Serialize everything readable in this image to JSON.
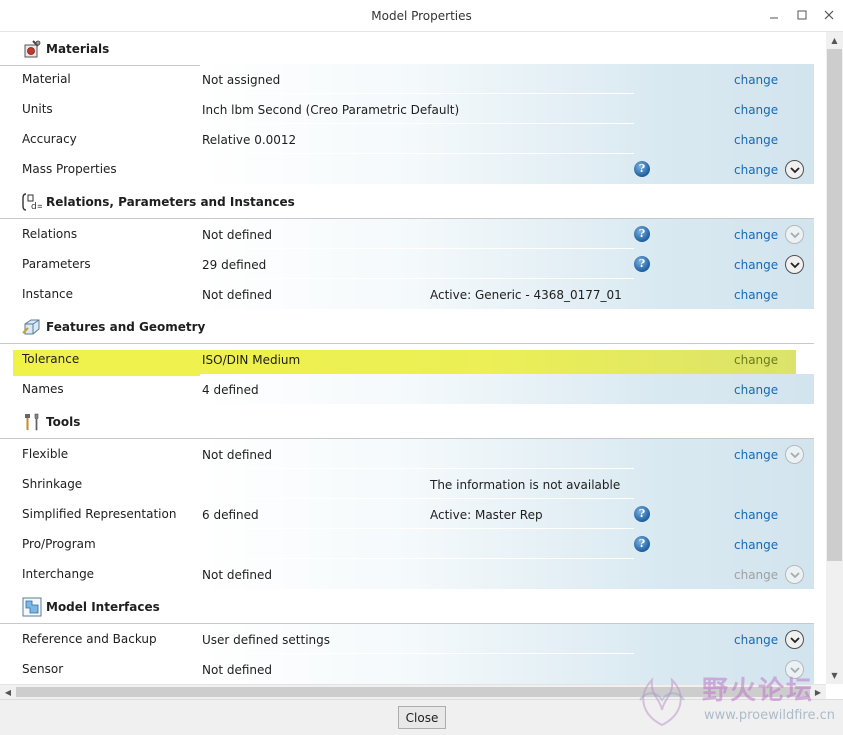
{
  "window": {
    "title": "Model Properties"
  },
  "sections": {
    "materials": {
      "title": "Materials",
      "rows": [
        {
          "label": "Material",
          "value": "Not assigned",
          "action": "change"
        },
        {
          "label": "Units",
          "value": "Inch lbm Second (Creo Parametric Default)",
          "action": "change"
        },
        {
          "label": "Accuracy",
          "value": "Relative 0.0012",
          "action": "change"
        },
        {
          "label": "Mass Properties",
          "value": "",
          "action": "change"
        }
      ]
    },
    "relations": {
      "title": "Relations, Parameters and Instances",
      "rows": [
        {
          "label": "Relations",
          "value": "Not defined",
          "action": "change"
        },
        {
          "label": "Parameters",
          "value": "29 defined",
          "action": "change"
        },
        {
          "label": "Instance",
          "value": "Not defined",
          "extra": "Active: Generic - 4368_0177_01",
          "action": "change"
        }
      ]
    },
    "features": {
      "title": "Features and Geometry",
      "rows": [
        {
          "label": "Tolerance",
          "value": "ISO/DIN Medium",
          "action": "change"
        },
        {
          "label": "Names",
          "value": "4 defined",
          "action": "change"
        }
      ]
    },
    "tools": {
      "title": "Tools",
      "rows": [
        {
          "label": "Flexible",
          "value": "Not defined",
          "action": "change"
        },
        {
          "label": "Shrinkage",
          "value": "",
          "extra": "The information is not available"
        },
        {
          "label": "Simplified Representation",
          "value": "6 defined",
          "extra": "Active: Master Rep",
          "action": "change"
        },
        {
          "label": "Pro/Program",
          "value": "",
          "action": "change"
        },
        {
          "label": "Interchange",
          "value": "Not defined",
          "action": "change"
        }
      ]
    },
    "interfaces": {
      "title": "Model Interfaces",
      "rows": [
        {
          "label": "Reference and Backup",
          "value": "User defined settings",
          "action": "change"
        },
        {
          "label": "Sensor",
          "value": "Not defined",
          "action": ""
        }
      ]
    }
  },
  "footer": {
    "close_label": "Close"
  },
  "watermark": {
    "text": "野火论坛",
    "url": "www.proewildfire.cn"
  },
  "colors": {
    "link": "#1769b6",
    "highlight": "#f0f24a",
    "disabled": "#a0a0a0"
  }
}
